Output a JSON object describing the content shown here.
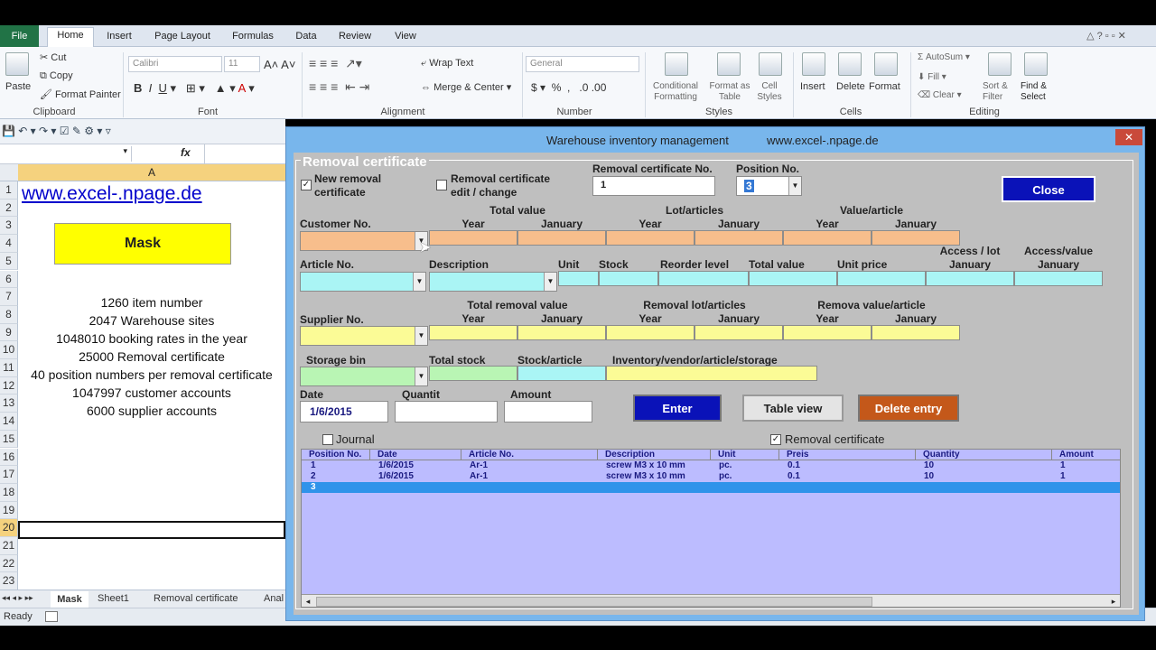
{
  "ribbon": {
    "file_tab": "File",
    "tabs": [
      "Home",
      "Insert",
      "Page Layout",
      "Formulas",
      "Data",
      "Review",
      "View"
    ],
    "clipboard": {
      "paste": "Paste",
      "cut": "Cut",
      "copy": "Copy",
      "format_painter": "Format Painter",
      "title": "Clipboard"
    },
    "font": {
      "name": "Calibri",
      "size": "11",
      "title": "Font"
    },
    "alignment": {
      "wrap": "Wrap Text",
      "merge": "Merge & Center",
      "title": "Alignment"
    },
    "number": {
      "format": "General",
      "title": "Number"
    },
    "styles": {
      "conditional": "Conditional Formatting",
      "format_table": "Format as Table",
      "cell_styles": "Cell Styles",
      "title": "Styles"
    },
    "cells": {
      "insert": "Insert",
      "delete": "Delete",
      "format": "Format",
      "title": "Cells"
    },
    "editing": {
      "autosum": "AutoSum",
      "fill": "Fill",
      "clear": "Clear",
      "sort": "Sort & Filter",
      "find": "Find & Select",
      "title": "Editing"
    }
  },
  "formula_bar": {
    "fx": "fx"
  },
  "sheet": {
    "column_header": "A",
    "rows": [
      "1",
      "2",
      "3",
      "4",
      "5",
      "6",
      "7",
      "8",
      "9",
      "10",
      "11",
      "12",
      "13",
      "14",
      "15",
      "16",
      "17",
      "18",
      "19",
      "20",
      "21",
      "22",
      "23"
    ],
    "link": "www.excel-.npage.de",
    "mask_button": "Mask",
    "stats": [
      "1260 item number",
      "2047 Warehouse sites",
      "1048010 booking rates in the year",
      "25000 Removal certificate",
      "40 position numbers per removal certificate",
      "1047997 customer accounts",
      "6000 supplier accounts"
    ],
    "sheet_tabs": [
      "Mask",
      "Sheet1",
      "Removal certificate",
      "Anal"
    ]
  },
  "status": {
    "ready": "Ready"
  },
  "dialog": {
    "title": "Warehouse inventory management",
    "url": "www.excel-.npage.de",
    "close_x": "✕",
    "frame_title": "Removal certificate",
    "new_removal": "New removal certificate",
    "edit_change": "Removal certificate edit / change",
    "removal_no_label": "Removal certificate No.",
    "removal_no_value": "1",
    "position_no_label": "Position No.",
    "position_no_value": "3",
    "close_button": "Close",
    "customer_no": "Customer No.",
    "total_value": "Total value",
    "lot_articles": "Lot/articles",
    "value_article": "Value/article",
    "year": "Year",
    "january": "January",
    "article_no": "Article No.",
    "description": "Description",
    "unit": "Unit",
    "stock": "Stock",
    "reorder_level": "Reorder level",
    "total_value2": "Total value",
    "unit_price": "Unit price",
    "access_lot": "Access / lot",
    "access_value": "Access/value",
    "supplier_no": "Supplier No.",
    "total_removal_value": "Total removal value",
    "removal_lot_articles": "Removal lot/articles",
    "remova_value_article": "Remova value/article",
    "storage_bin": "Storage bin",
    "total_stock": "Total stock",
    "stock_article": "Stock/article",
    "inventory_path": "Inventory/vendor/article/storage",
    "date_label": "Date",
    "date_value": "1/6/2015",
    "quantit_label": "Quantit",
    "amount_label": "Amount",
    "enter_button": "Enter",
    "table_view_button": "Table view",
    "delete_button": "Delete entry",
    "journal": "Journal",
    "removal_certificate_chk": "Removal certificate",
    "columns": [
      "Position No.",
      "Date",
      "Article No.",
      "Description",
      "Unit",
      "Preis",
      "Quantity",
      "Amount"
    ],
    "rows": [
      [
        "1",
        "1/6/2015",
        "Ar-1",
        "screw M3 x 10 mm",
        "pc.",
        "0.1",
        "10",
        "1"
      ],
      [
        "2",
        "1/6/2015",
        "Ar-1",
        "screw M3 x 10 mm",
        "pc.",
        "0.1",
        "10",
        "1"
      ],
      [
        "3",
        "",
        "",
        "",
        "",
        "",
        "",
        ""
      ]
    ]
  }
}
